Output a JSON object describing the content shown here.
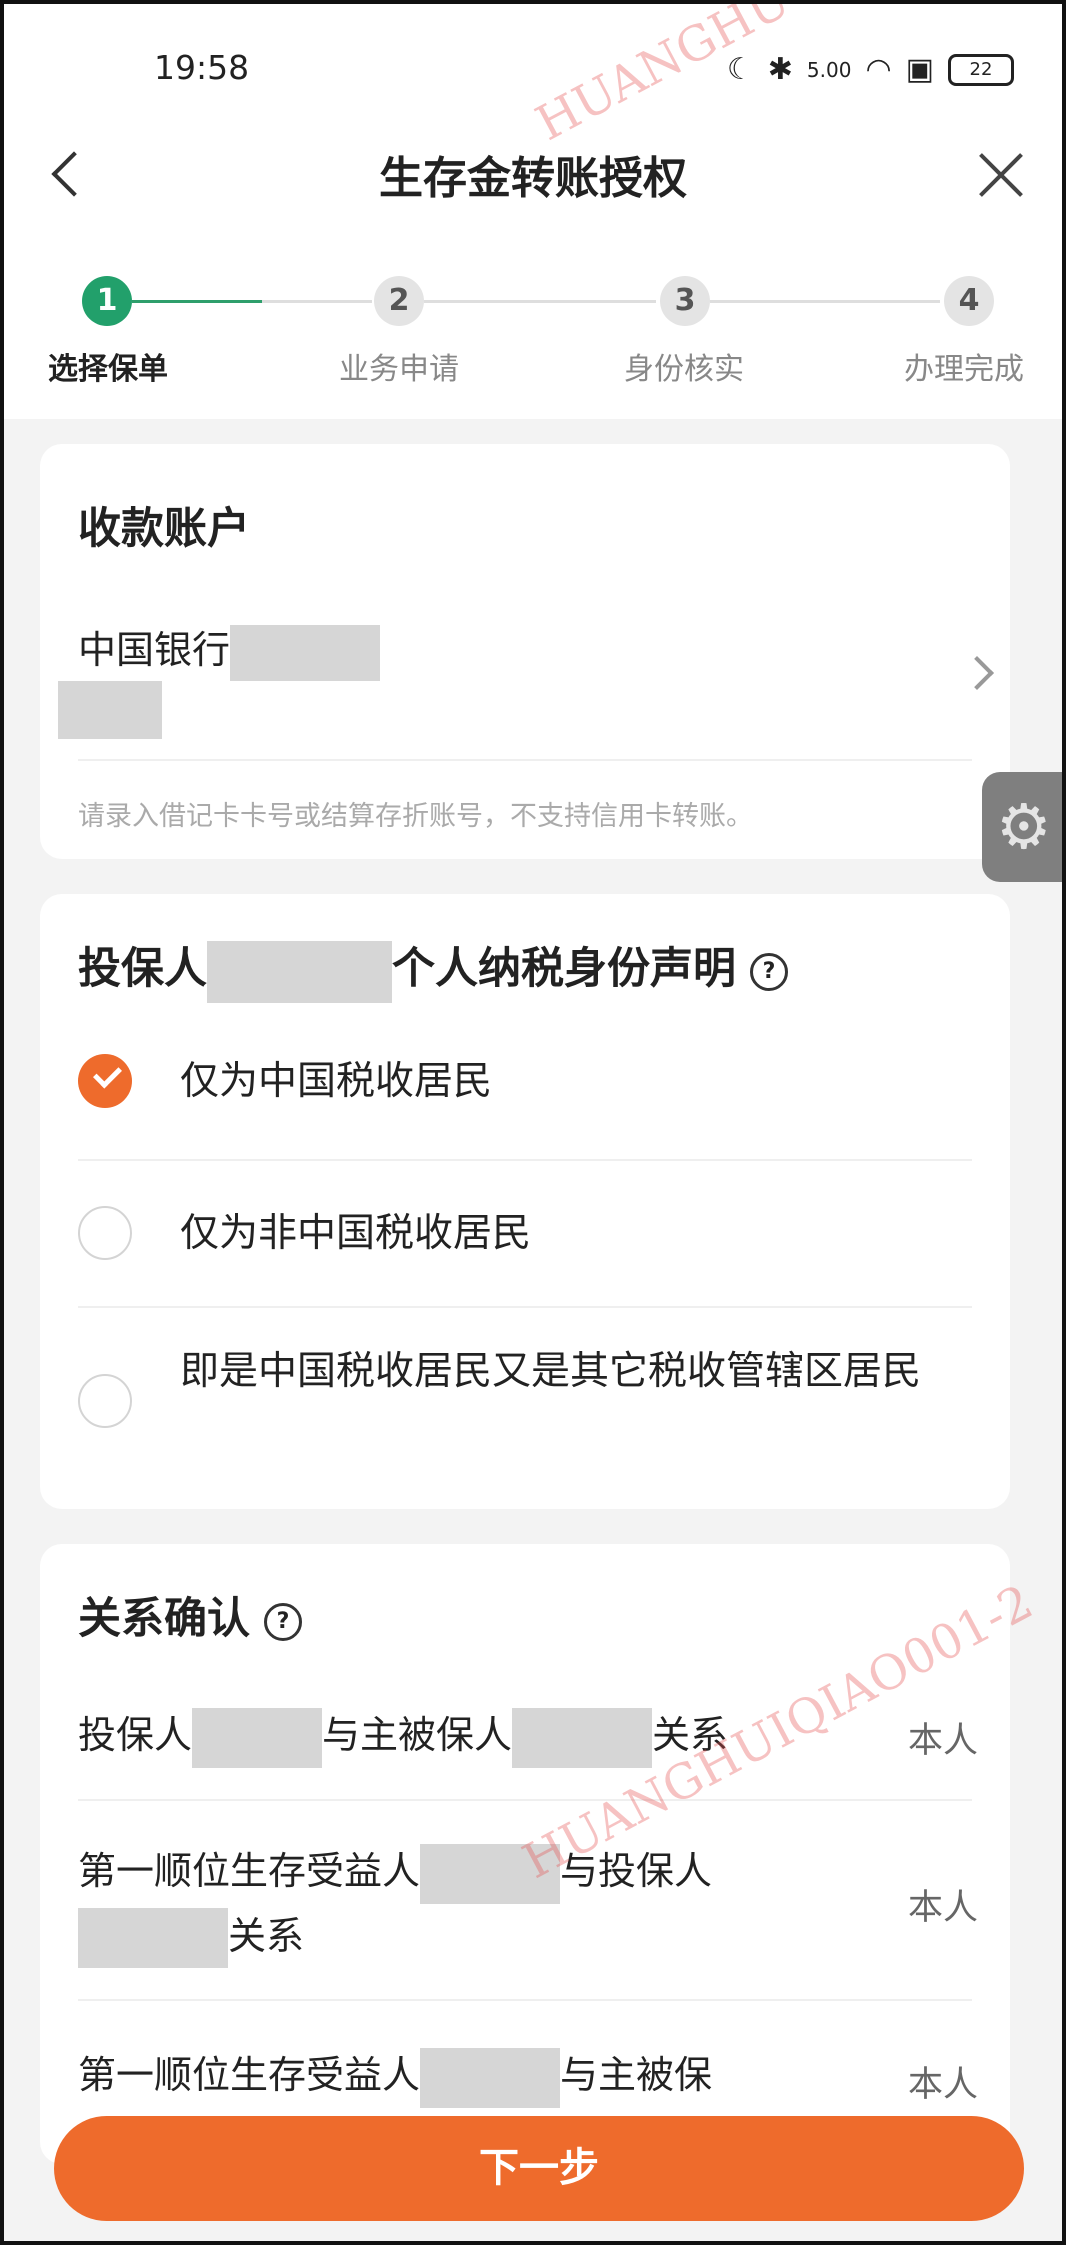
{
  "status_bar": {
    "time": "19:58",
    "speed": "5.00",
    "battery": "22"
  },
  "nav": {
    "title": "生存金转账授权"
  },
  "steps": [
    {
      "num": "1",
      "label": "选择保单"
    },
    {
      "num": "2",
      "label": "业务申请"
    },
    {
      "num": "3",
      "label": "身份核实"
    },
    {
      "num": "4",
      "label": "办理完成"
    }
  ],
  "account_card": {
    "title": "收款账户",
    "bank": "中国银行",
    "hint": "请录入借记卡卡号或结算存折账号，不支持信用卡转账。"
  },
  "tax_card": {
    "title_prefix": "投保人",
    "title_suffix": "个人纳税身份声明",
    "help": "?",
    "options": [
      {
        "label": "仅为中国税收居民",
        "checked": true
      },
      {
        "label": "仅为非中国税收居民",
        "checked": false
      },
      {
        "label": "即是中国税收居民又是其它税收管辖区居民",
        "checked": false
      }
    ]
  },
  "relation_card": {
    "title": "关系确认",
    "help": "?",
    "rows": [
      {
        "p1": "投保人",
        "p2": "与主被保人",
        "p3": "关系",
        "value": "本人"
      },
      {
        "p1": "第一顺位生存受益人",
        "p2": "与投保人",
        "p3": "关系",
        "value": "本人"
      },
      {
        "p1": "第一顺位生存受益人",
        "p2": "与主被保",
        "value": "本人"
      }
    ]
  },
  "footer": {
    "next_label": "下一步"
  },
  "watermark": {
    "text1": "HUANGHUIQIAO001-2",
    "text2": "HUANGHU"
  },
  "colors": {
    "accent": "#ee6b2c",
    "step_active": "#22a06b"
  }
}
